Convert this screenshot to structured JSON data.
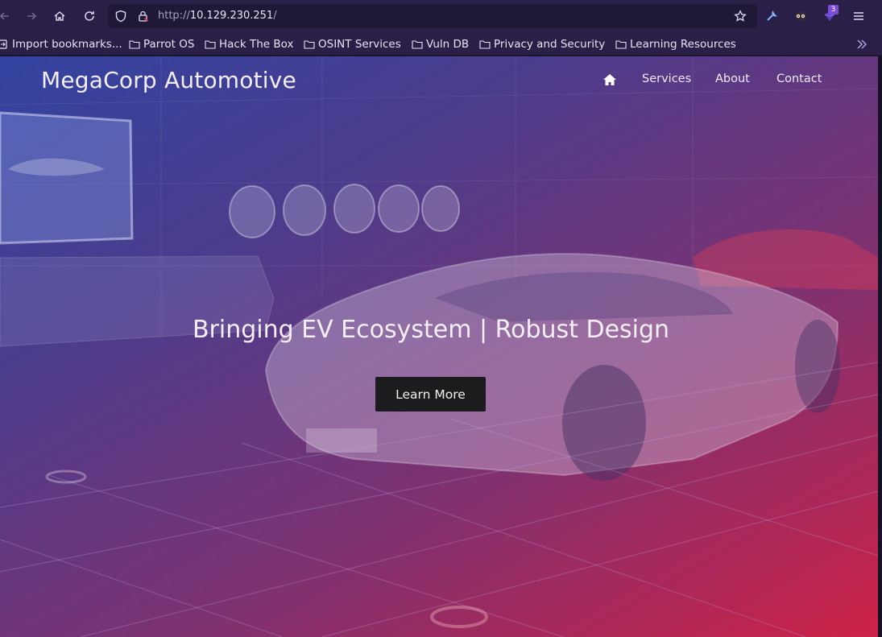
{
  "browser": {
    "url_scheme": "http://",
    "url_host": "10.129.230.251",
    "url_path": "/",
    "extension_badge": "3",
    "icons": [
      "back-icon",
      "forward-icon",
      "home-icon",
      "reload-icon",
      "shield-icon",
      "lock-icon",
      "star-icon",
      "wrench-icon",
      "mask-icon",
      "extension-icon",
      "menu-icon",
      "chevron-double-right-icon",
      "folder-icon"
    ]
  },
  "bookmarks": [
    "Import bookmarks...",
    "Parrot OS",
    "Hack The Box",
    "OSINT Services",
    "Vuln DB",
    "Privacy and Security",
    "Learning Resources"
  ],
  "site": {
    "brand": "MegaCorp Automotive",
    "nav": [
      "Services",
      "About",
      "Contact"
    ],
    "headline": "Bringing EV Ecosystem | Robust Design",
    "cta": "Learn More"
  },
  "colors": {
    "gradient_start": "#3446aa",
    "gradient_end": "#d62248",
    "button": "#1c1c1f",
    "chrome": "#2a1f47"
  }
}
